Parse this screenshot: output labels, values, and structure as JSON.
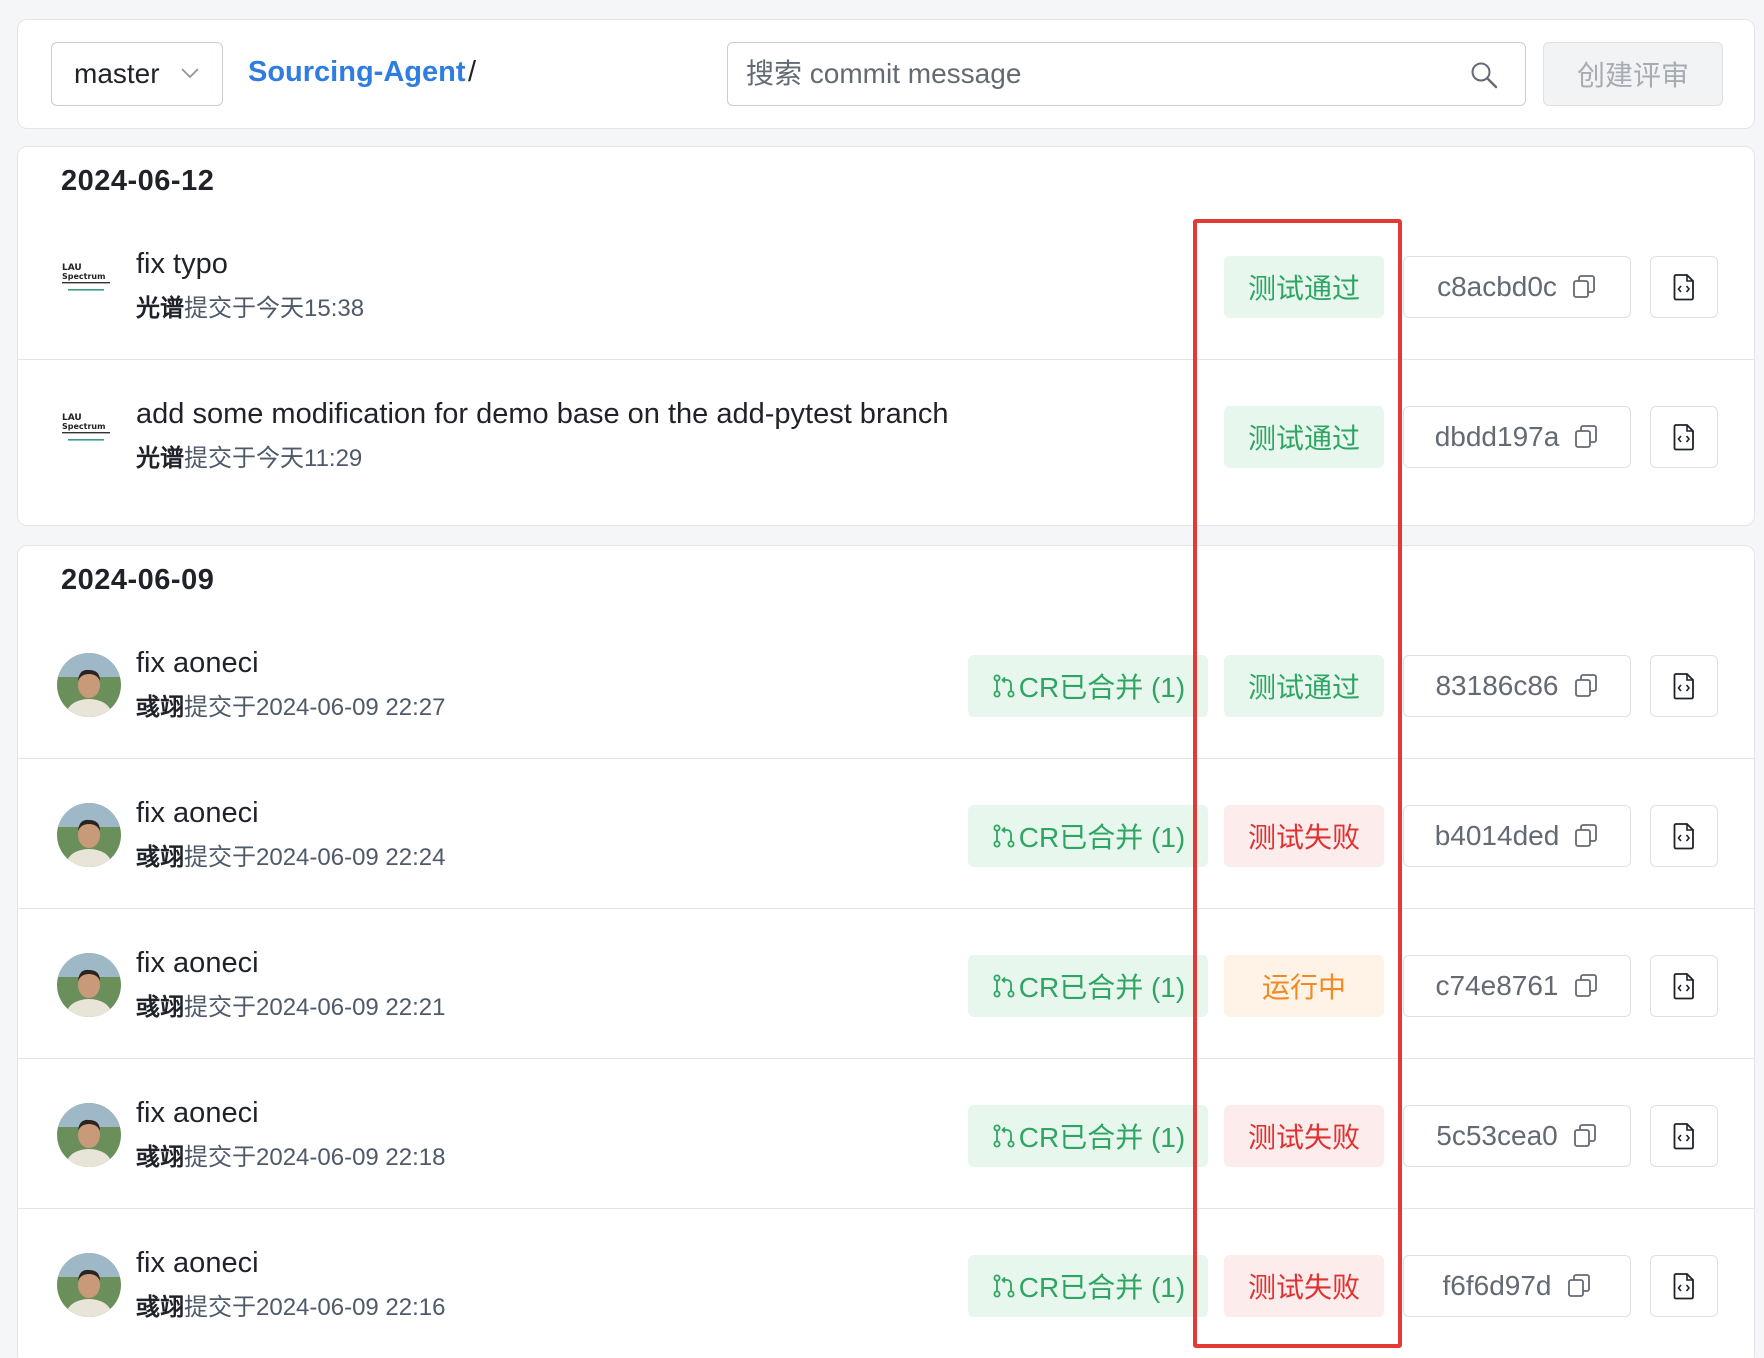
{
  "toolbar": {
    "branch": "master",
    "repo": "Sourcing-Agent",
    "separator": "/",
    "search_placeholder": "搜索 commit message",
    "create_review": "创建评审"
  },
  "groups": [
    {
      "date": "2024-06-12",
      "commits": [
        {
          "message": "fix typo",
          "author": "光谱",
          "verb": "提交于",
          "time": "今天15:38",
          "status": "测试通过",
          "hash": "c8acbd0c"
        },
        {
          "message": "add some modification for demo base on the add-pytest branch",
          "author": "光谱",
          "verb": "提交于",
          "time": "今天11:29",
          "status": "测试通过",
          "hash": "dbdd197a"
        }
      ]
    },
    {
      "date": "2024-06-09",
      "commits": [
        {
          "message": "fix aoneci",
          "author": "彧翊",
          "verb": "提交于",
          "time": "2024-06-09 22:27",
          "cr": "CR已合并 (1)",
          "status": "测试通过",
          "hash": "83186c86"
        },
        {
          "message": "fix aoneci",
          "author": "彧翊",
          "verb": "提交于",
          "time": "2024-06-09 22:24",
          "cr": "CR已合并 (1)",
          "status": "测试失败",
          "hash": "b4014ded"
        },
        {
          "message": "fix aoneci",
          "author": "彧翊",
          "verb": "提交于",
          "time": "2024-06-09 22:21",
          "cr": "CR已合并 (1)",
          "status": "运行中",
          "hash": "c74e8761"
        },
        {
          "message": "fix aoneci",
          "author": "彧翊",
          "verb": "提交于",
          "time": "2024-06-09 22:18",
          "cr": "CR已合并 (1)",
          "status": "测试失败",
          "hash": "5c53cea0"
        },
        {
          "message": "fix aoneci",
          "author": "彧翊",
          "verb": "提交于",
          "time": "2024-06-09 22:16",
          "cr": "CR已合并 (1)",
          "status": "测试失败",
          "hash": "f6f6d97d"
        }
      ]
    }
  ],
  "colors": {
    "accent": "#2f7de1",
    "pass": "#2ea563",
    "fail": "#e03131",
    "running": "#f08a24",
    "highlight": "#e53935"
  }
}
